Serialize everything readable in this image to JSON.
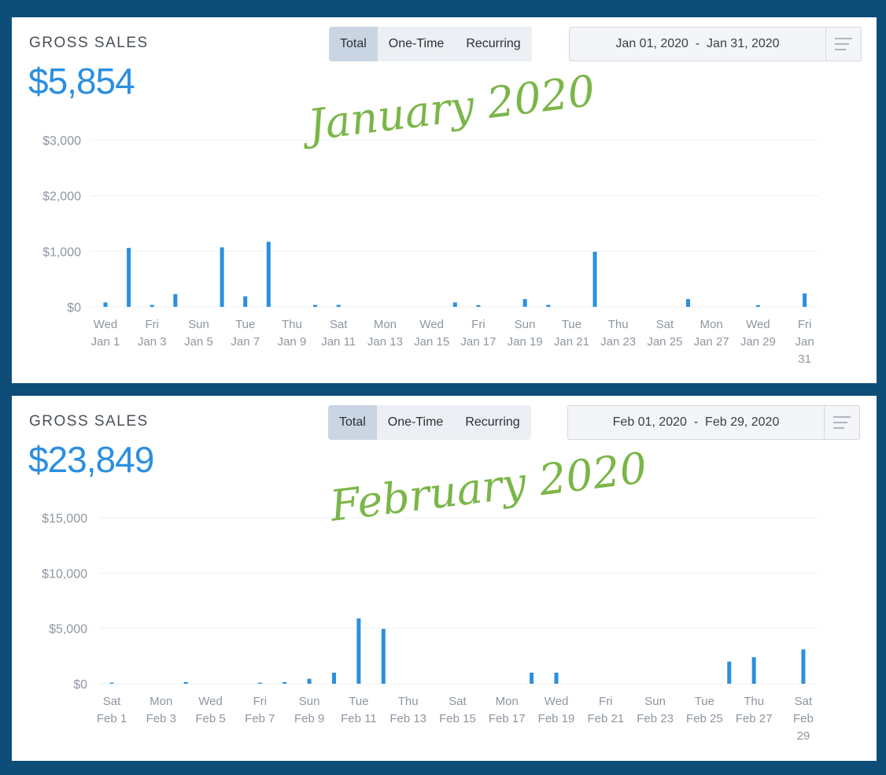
{
  "panels": [
    {
      "gross_sales_label": "GROSS SALES",
      "gross_sales_value": "$5,854",
      "toggle": [
        "Total",
        "One-Time",
        "Recurring"
      ],
      "date_range": "Jan 01, 2020  -  Jan 31, 2020",
      "annotation": "January 2020"
    },
    {
      "gross_sales_label": "GROSS SALES",
      "gross_sales_value": "$23,849",
      "toggle": [
        "Total",
        "One-Time",
        "Recurring"
      ],
      "date_range": "Feb 01, 2020  -  Feb 29, 2020",
      "annotation": "February 2020"
    }
  ],
  "colors": {
    "bar": "#2b8fe0",
    "value": "#2b8fe0",
    "annotation": "#7ab648",
    "frame": "#0d4d78"
  },
  "chart_data": [
    {
      "type": "bar",
      "title": "",
      "xlabel": "",
      "ylabel": "",
      "ylim": [
        0,
        3000
      ],
      "yticks": [
        "$0",
        "$1,000",
        "$2,000",
        "$3,000"
      ],
      "ytick_values": [
        0,
        1000,
        2000,
        3000
      ],
      "grid": true,
      "x": [
        "Jan 1",
        "Jan 2",
        "Jan 3",
        "Jan 4",
        "Jan 5",
        "Jan 6",
        "Jan 7",
        "Jan 8",
        "Jan 9",
        "Jan 10",
        "Jan 11",
        "Jan 12",
        "Jan 13",
        "Jan 14",
        "Jan 15",
        "Jan 16",
        "Jan 17",
        "Jan 18",
        "Jan 19",
        "Jan 20",
        "Jan 21",
        "Jan 22",
        "Jan 23",
        "Jan 24",
        "Jan 25",
        "Jan 26",
        "Jan 27",
        "Jan 28",
        "Jan 29",
        "Jan 30",
        "Jan 31"
      ],
      "values": [
        80,
        1060,
        35,
        230,
        0,
        1070,
        190,
        1170,
        0,
        35,
        35,
        0,
        0,
        0,
        0,
        80,
        30,
        0,
        140,
        35,
        0,
        990,
        0,
        0,
        0,
        140,
        0,
        0,
        30,
        0,
        240
      ],
      "x_tick_labels": [
        [
          "Wed",
          "Jan 1"
        ],
        [
          "Fri",
          "Jan 3"
        ],
        [
          "Sun",
          "Jan 5"
        ],
        [
          "Tue",
          "Jan 7"
        ],
        [
          "Thu",
          "Jan 9"
        ],
        [
          "Sat",
          "Jan 11"
        ],
        [
          "Mon",
          "Jan 13"
        ],
        [
          "Wed",
          "Jan 15"
        ],
        [
          "Fri",
          "Jan 17"
        ],
        [
          "Sun",
          "Jan 19"
        ],
        [
          "Tue",
          "Jan 21"
        ],
        [
          "Thu",
          "Jan 23"
        ],
        [
          "Sat",
          "Jan 25"
        ],
        [
          "Mon",
          "Jan 27"
        ],
        [
          "Wed",
          "Jan 29"
        ],
        [
          "Fri",
          "Jan",
          "31"
        ]
      ]
    },
    {
      "type": "bar",
      "title": "",
      "xlabel": "",
      "ylabel": "",
      "ylim": [
        0,
        15000
      ],
      "yticks": [
        "$0",
        "$5,000",
        "$10,000",
        "$15,000"
      ],
      "ytick_values": [
        0,
        5000,
        10000,
        15000
      ],
      "grid": true,
      "x": [
        "Feb 1",
        "Feb 2",
        "Feb 3",
        "Feb 4",
        "Feb 5",
        "Feb 6",
        "Feb 7",
        "Feb 8",
        "Feb 9",
        "Feb 10",
        "Feb 11",
        "Feb 12",
        "Feb 13",
        "Feb 14",
        "Feb 15",
        "Feb 16",
        "Feb 17",
        "Feb 18",
        "Feb 19",
        "Feb 20",
        "Feb 21",
        "Feb 22",
        "Feb 23",
        "Feb 24",
        "Feb 25",
        "Feb 26",
        "Feb 27",
        "Feb 28",
        "Feb 29"
      ],
      "values": [
        100,
        0,
        0,
        150,
        0,
        0,
        100,
        150,
        450,
        1000,
        5900,
        4950,
        0,
        0,
        0,
        0,
        0,
        1000,
        1000,
        0,
        0,
        0,
        0,
        0,
        0,
        2000,
        2400,
        0,
        3100
      ],
      "x_tick_labels": [
        [
          "Sat",
          "Feb 1"
        ],
        [
          "Mon",
          "Feb 3"
        ],
        [
          "Wed",
          "Feb 5"
        ],
        [
          "Fri",
          "Feb 7"
        ],
        [
          "Sun",
          "Feb 9"
        ],
        [
          "Tue",
          "Feb 11"
        ],
        [
          "Thu",
          "Feb 13"
        ],
        [
          "Sat",
          "Feb 15"
        ],
        [
          "Mon",
          "Feb 17"
        ],
        [
          "Wed",
          "Feb 19"
        ],
        [
          "Fri",
          "Feb 21"
        ],
        [
          "Sun",
          "Feb 23"
        ],
        [
          "Tue",
          "Feb 25"
        ],
        [
          "Thu",
          "Feb 27"
        ],
        [
          "Sat",
          "Feb",
          "29"
        ]
      ]
    }
  ]
}
